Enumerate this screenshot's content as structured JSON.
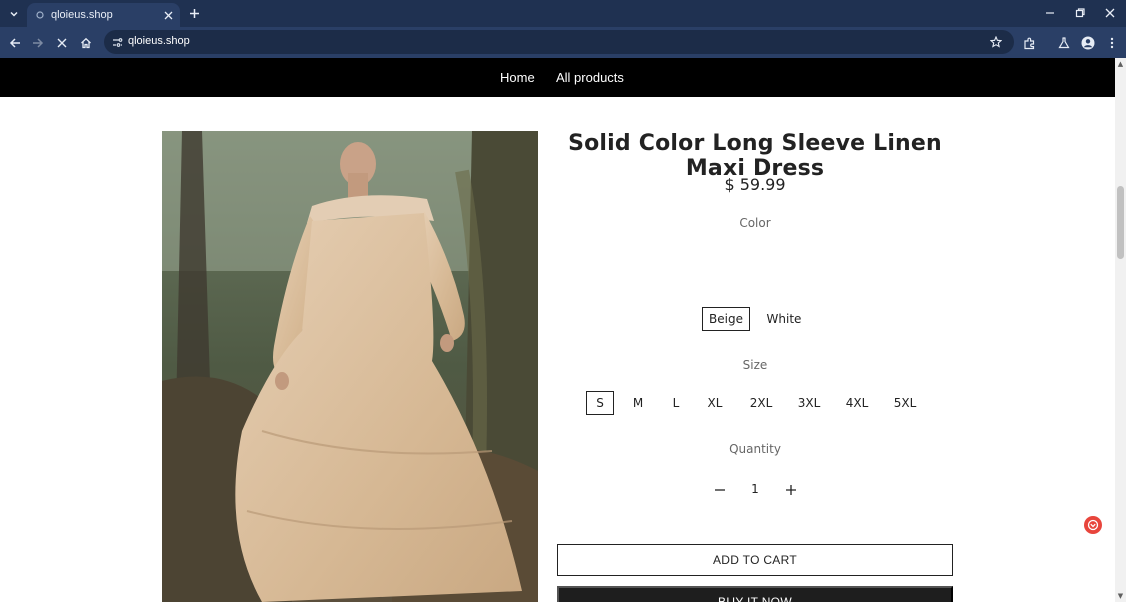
{
  "browser": {
    "tab_title": "qloieus.shop",
    "url": "qloieus.shop",
    "icons": [
      "tab-search-icon",
      "favicon-icon",
      "close-icon",
      "new-tab-icon",
      "minimize-icon",
      "restore-icon",
      "close-window-icon",
      "back-icon",
      "forward-icon",
      "stop-icon",
      "home-icon",
      "site-info-icon",
      "star-icon",
      "extensions-icon",
      "labs-icon",
      "profile-icon",
      "more-icon"
    ]
  },
  "nav": {
    "home": "Home",
    "all_products": "All products"
  },
  "product": {
    "title": "Solid Color Long Sleeve Linen Maxi Dress",
    "price": "$ 59.99",
    "color_label": "Color",
    "colors": [
      "Beige",
      "White"
    ],
    "selected_color": "Beige",
    "size_label": "Size",
    "sizes": [
      "S",
      "M",
      "L",
      "XL",
      "2XL",
      "3XL",
      "4XL",
      "5XL"
    ],
    "selected_size": "S",
    "quantity_label": "Quantity",
    "quantity": "1",
    "add_to_cart": "ADD TO CART",
    "buy_now": "BUY IT NOW"
  },
  "colors": {
    "chrome_tabbar": "#1f3151",
    "chrome_toolbar": "#2a3f66",
    "nav_bg": "#000000",
    "buy_now_bg": "#1e1e1e",
    "chat_widget": "#e8453c"
  }
}
